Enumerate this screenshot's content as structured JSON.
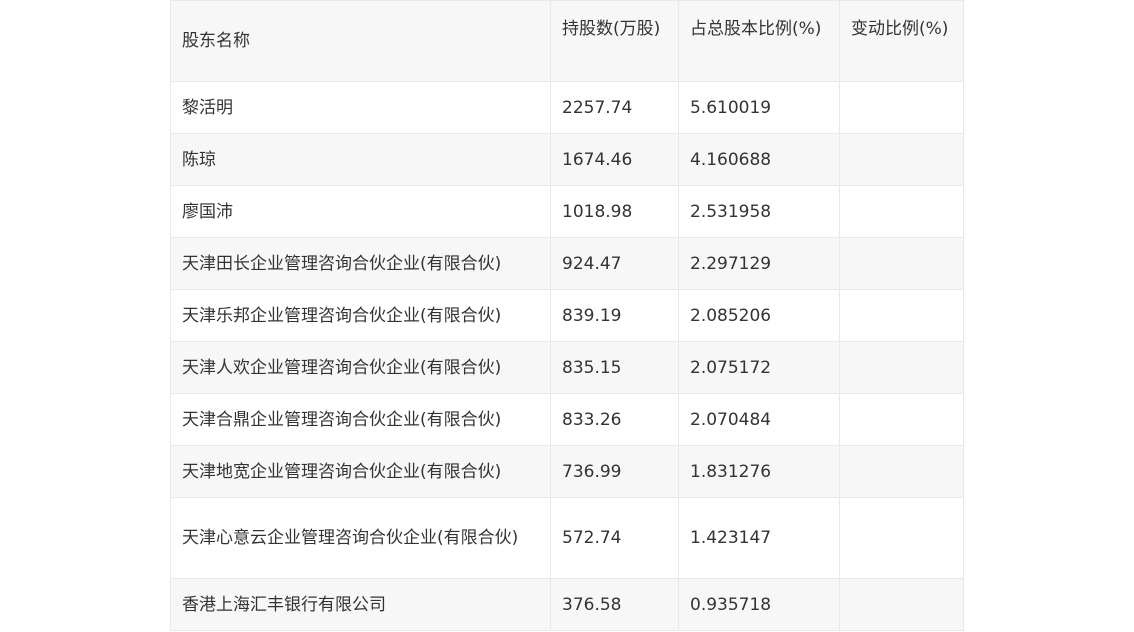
{
  "table": {
    "headers": [
      "股东名称",
      "持股数(万股)",
      "占总股本比例(%)",
      "变动比例(%)"
    ],
    "rows": [
      [
        "黎活明",
        "2257.74",
        "5.610019",
        ""
      ],
      [
        "陈琼",
        "1674.46",
        "4.160688",
        ""
      ],
      [
        "廖国沛",
        "1018.98",
        "2.531958",
        ""
      ],
      [
        "天津田长企业管理咨询合伙企业(有限合伙)",
        "924.47",
        "2.297129",
        ""
      ],
      [
        "天津乐邦企业管理咨询合伙企业(有限合伙)",
        "839.19",
        "2.085206",
        ""
      ],
      [
        "天津人欢企业管理咨询合伙企业(有限合伙)",
        "835.15",
        "2.075172",
        ""
      ],
      [
        "天津合鼎企业管理咨询合伙企业(有限合伙)",
        "833.26",
        "2.070484",
        ""
      ],
      [
        "天津地宽企业管理咨询合伙企业(有限合伙)",
        "736.99",
        "1.831276",
        ""
      ],
      [
        "天津心意云企业管理咨询合伙企业(有限合伙)",
        "572.74",
        "1.423147",
        ""
      ],
      [
        "香港上海汇丰银行有限公司",
        "376.58",
        "0.935718",
        ""
      ]
    ]
  }
}
